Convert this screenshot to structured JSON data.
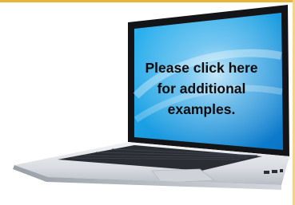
{
  "cta": {
    "text": "Please click here for additional examples."
  },
  "icons": {
    "laptop": "laptop-icon"
  },
  "colors": {
    "screen_blue": "#1aa3e6",
    "screen_light": "#bfe6fb",
    "body_silver": "#e4e6ea",
    "keyboard_dark": "#2a2d33",
    "bezel_black": "#121418",
    "border_gold": "#e8b53c"
  }
}
